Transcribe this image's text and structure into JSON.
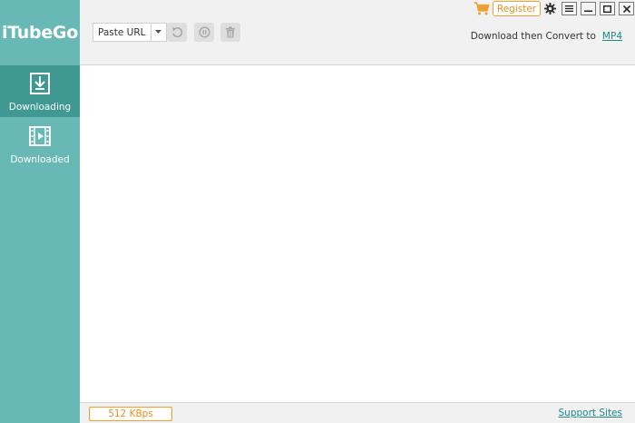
{
  "app": {
    "title": "iTubeGo"
  },
  "sidebar": {
    "items": [
      {
        "label": "Downloading",
        "icon": "download-icon",
        "active": true
      },
      {
        "label": "Downloaded",
        "icon": "film-icon",
        "active": false
      }
    ]
  },
  "toolbar": {
    "paste_label": "Paste URL",
    "paste_dropdown_icon": "caret-down-icon",
    "retry_icon": "refresh-icon",
    "pause_icon": "pause-icon",
    "delete_icon": "trash-icon"
  },
  "header": {
    "register_label": "Register",
    "convert_label": "Download then Convert to",
    "convert_format": "MP4"
  },
  "window_controls": [
    "menu-icon",
    "minimize-icon",
    "maximize-icon",
    "close-icon"
  ],
  "status": {
    "speed": "512 KBps",
    "support_label": "Support Sites"
  },
  "colors": {
    "sidebar": "#68b8b6",
    "sidebar_active": "#3f9891",
    "accent_orange": "#e8901a",
    "link": "#1d8a86"
  }
}
